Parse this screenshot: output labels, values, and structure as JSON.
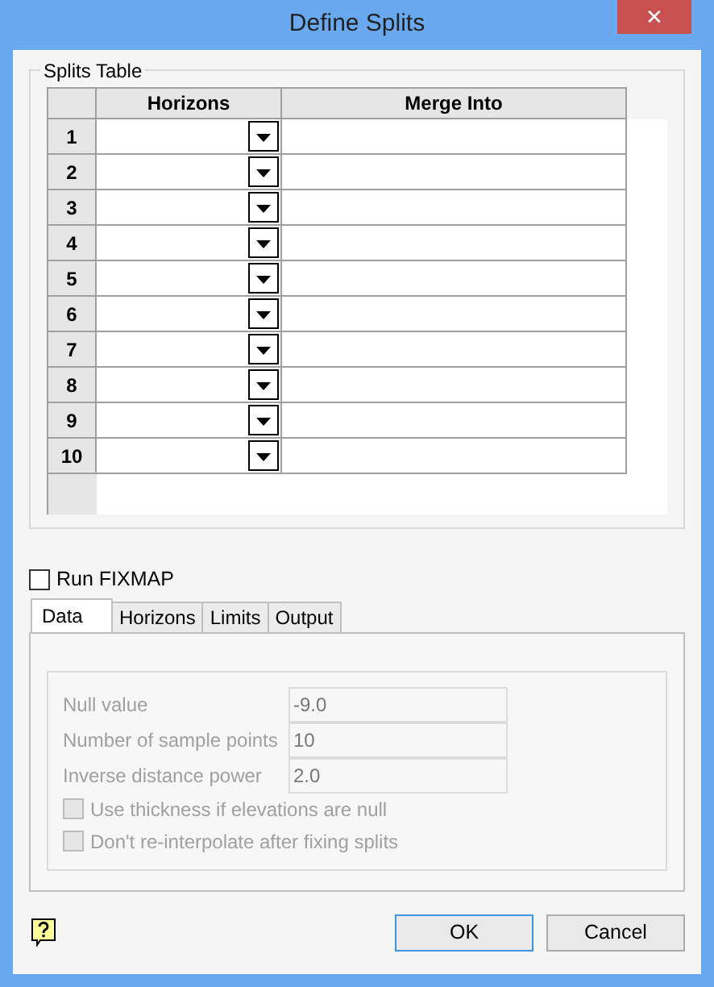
{
  "window": {
    "title": "Define Splits",
    "close": "✕"
  },
  "splits_table": {
    "title": "Splits Table",
    "columns": [
      "Horizons",
      "Merge Into"
    ],
    "rows": [
      {
        "number": "1"
      },
      {
        "number": "2"
      },
      {
        "number": "3"
      },
      {
        "number": "4"
      },
      {
        "number": "5"
      },
      {
        "number": "6"
      },
      {
        "number": "7"
      },
      {
        "number": "8"
      },
      {
        "number": "9"
      },
      {
        "number": "10"
      }
    ]
  },
  "run_fixmap": {
    "label": "Run FIXMAP",
    "checked": false
  },
  "tabs": [
    {
      "label": "Data",
      "selected": true
    },
    {
      "label": "Horizons",
      "selected": false
    },
    {
      "label": "Limits",
      "selected": false
    },
    {
      "label": "Output",
      "selected": false
    }
  ],
  "data_tab": {
    "disabled": true,
    "fields": [
      {
        "label": "Null value",
        "value": "-9.0"
      },
      {
        "label": "Number of sample points",
        "value": "10"
      },
      {
        "label": "Inverse distance power",
        "value": "2.0"
      }
    ],
    "checkboxes": [
      {
        "label": "Use thickness if elevations are null",
        "checked": false
      },
      {
        "label": "Don't re-interpolate after fixing splits",
        "checked": false
      }
    ]
  },
  "buttons": [
    {
      "label": "OK",
      "default": true
    },
    {
      "label": "Cancel",
      "default": false
    }
  ]
}
